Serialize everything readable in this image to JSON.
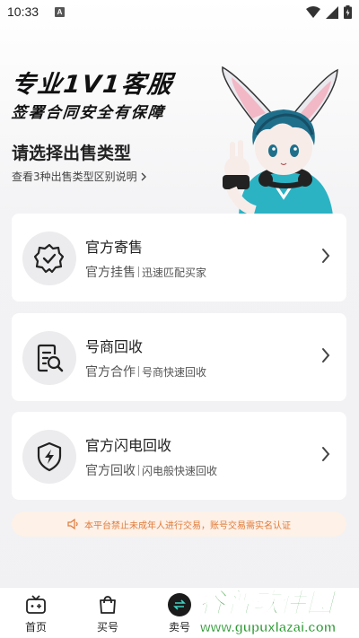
{
  "status_bar": {
    "time": "10:33",
    "notification_badge": "A"
  },
  "hero": {
    "title": "专业1V1客服",
    "subtitle": "签署合同安全有保障"
  },
  "section": {
    "title": "请选择出售类型",
    "link": "查看3种出售类型区别说明"
  },
  "cards": [
    {
      "title": "官方寄售",
      "sub": "官方挂售",
      "desc": "迅速匹配买家",
      "icon": "verified-badge-icon"
    },
    {
      "title": "号商回收",
      "sub": "官方合作",
      "desc": "号商快速回收",
      "icon": "document-search-icon"
    },
    {
      "title": "官方闪电回收",
      "sub": "官方回收",
      "desc": "闪电般快速回收",
      "icon": "lightning-shield-icon"
    }
  ],
  "notice": {
    "text": "本平台禁止未成年人进行交易，账号交易需实名认证"
  },
  "bottom_nav": [
    {
      "label": "首页",
      "icon": "home-tv-icon"
    },
    {
      "label": "买号",
      "icon": "shopping-bag-icon"
    },
    {
      "label": "卖号",
      "icon": "swap-icon"
    }
  ],
  "watermark": {
    "brand": "谷普软件园",
    "url": "www.gupuxlazai.com"
  },
  "colors": {
    "accent": "#1b1b1b",
    "notice": "#e07b39",
    "notice_bg": "#fdf1e8"
  }
}
